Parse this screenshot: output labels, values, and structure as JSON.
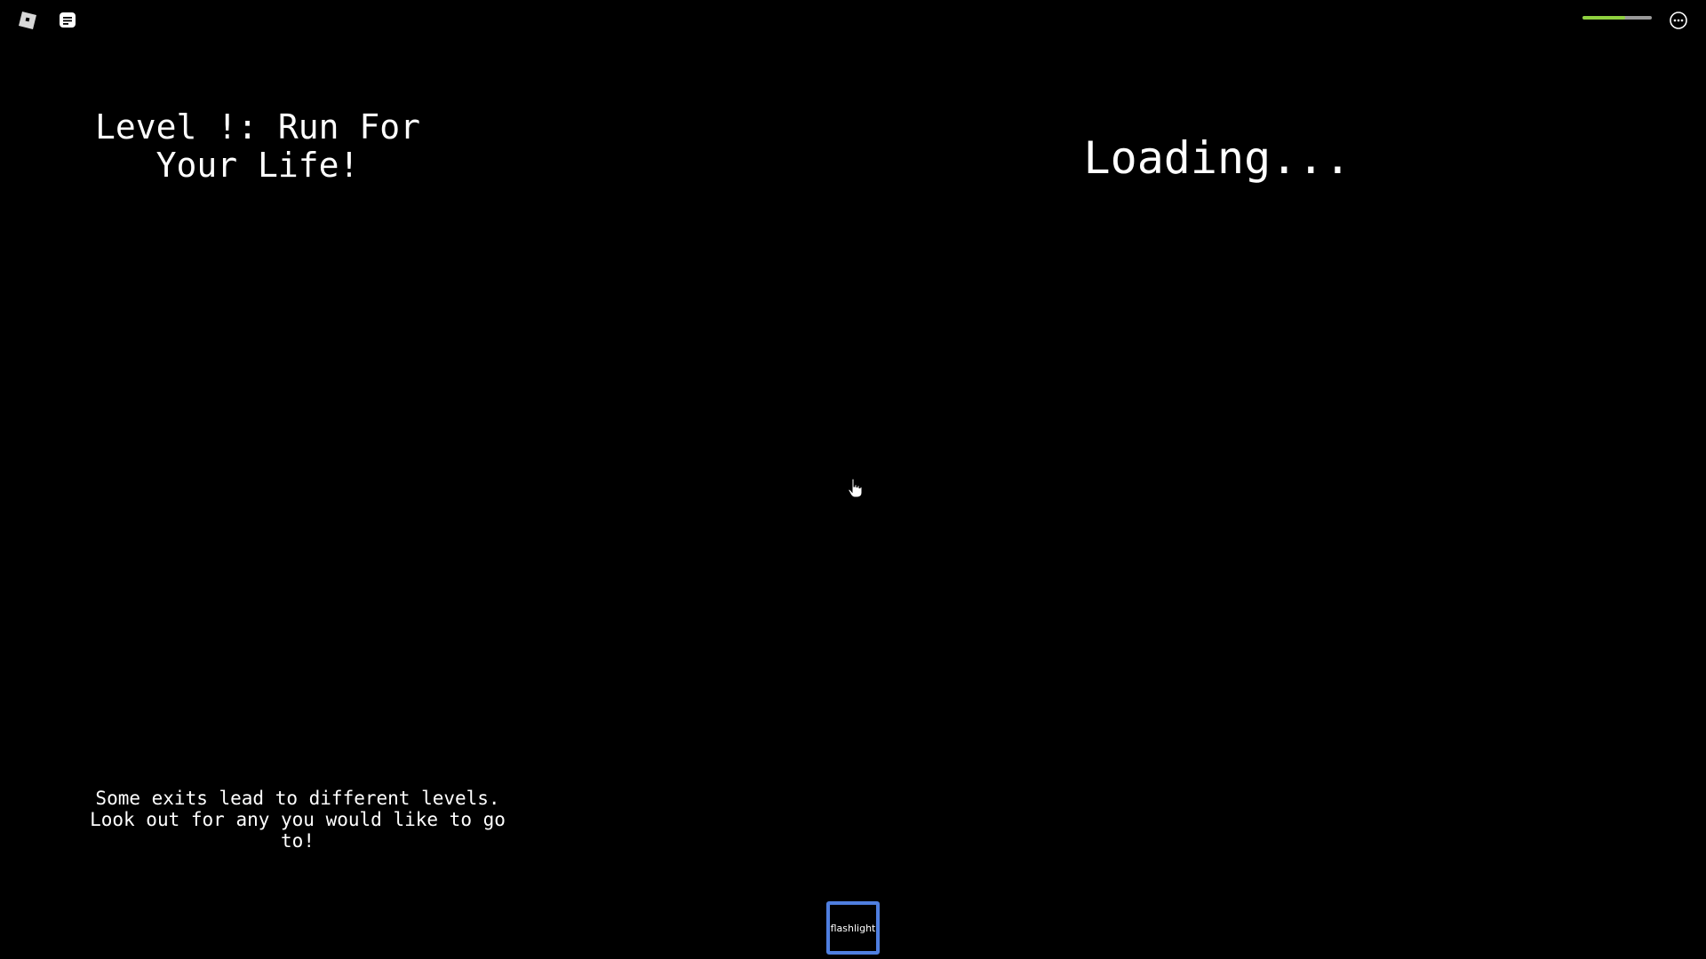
{
  "topbar": {
    "menu_icon": "roblox-logo-icon",
    "chat_icon": "chat-icon",
    "more_icon": "more-options-icon"
  },
  "health": {
    "level": 0.62,
    "fill_color": "#8fd13f",
    "track_color": "#9a9a9a"
  },
  "hud": {
    "level_title": "Level !: Run For Your Life!",
    "loading_text": "Loading...",
    "hint": "Some exits lead to different levels. Look out for any you would like to go to!"
  },
  "hotbar": {
    "slot_label": "flashlight",
    "selected_color": "#4f7fe0"
  },
  "cursor": {
    "icon": "hand-pointer-icon"
  }
}
